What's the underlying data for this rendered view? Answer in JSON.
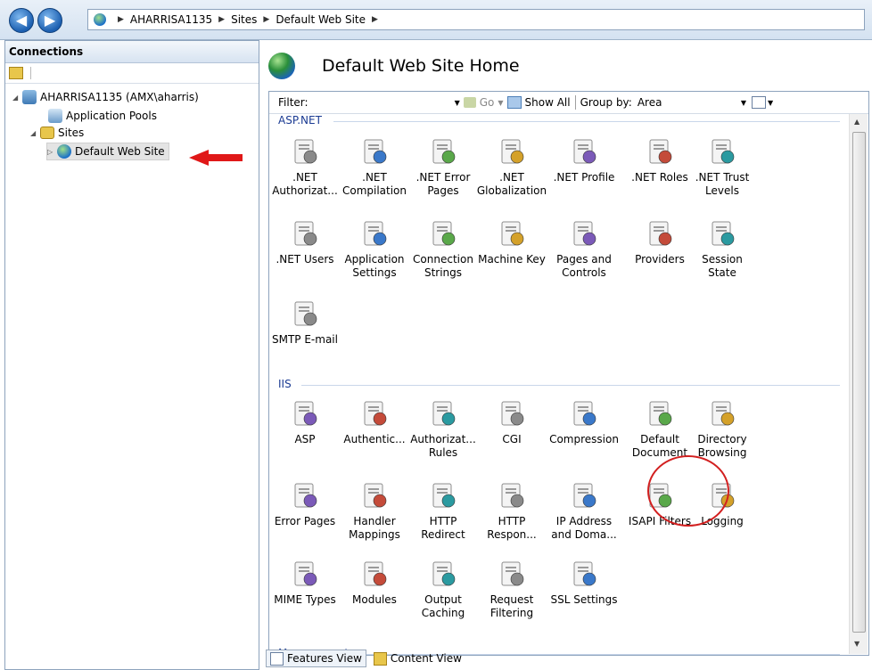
{
  "breadcrumb": [
    "AHARRISA1135",
    "Sites",
    "Default Web Site"
  ],
  "connections": {
    "title": "Connections",
    "tree": [
      {
        "label": "AHARRISA1135 (AMX\\aharris)",
        "icon": "server-icon",
        "expanded": true
      },
      {
        "label": "Application Pools",
        "icon": "app-pools-icon"
      },
      {
        "label": "Sites",
        "icon": "sites-folder-icon",
        "expanded": true
      },
      {
        "label": "Default Web Site",
        "icon": "globe-icon",
        "selected": true
      }
    ]
  },
  "main": {
    "title": "Default Web Site Home",
    "filter_label": "Filter:",
    "go_label": "Go",
    "show_all_label": "Show All",
    "group_by_label": "Group by:",
    "group_by_value": "Area"
  },
  "groups": {
    "aspnet": {
      "label": "ASP.NET",
      "items": [
        {
          "label": ".NET Authorizat...",
          "icon": "net-authorization-icon"
        },
        {
          "label": ".NET Compilation",
          "icon": "net-compilation-icon"
        },
        {
          "label": ".NET Error Pages",
          "icon": "net-error-pages-icon"
        },
        {
          "label": ".NET Globalization",
          "icon": "net-globalization-icon"
        },
        {
          "label": ".NET Profile",
          "icon": "net-profile-icon"
        },
        {
          "label": ".NET Roles",
          "icon": "net-roles-icon"
        },
        {
          "label": ".NET Trust Levels",
          "icon": "net-trust-levels-icon"
        },
        {
          "label": ".NET Users",
          "icon": "net-users-icon"
        },
        {
          "label": "Application Settings",
          "icon": "application-settings-icon"
        },
        {
          "label": "Connection Strings",
          "icon": "connection-strings-icon"
        },
        {
          "label": "Machine Key",
          "icon": "machine-key-icon"
        },
        {
          "label": "Pages and Controls",
          "icon": "pages-controls-icon"
        },
        {
          "label": "Providers",
          "icon": "providers-icon"
        },
        {
          "label": "Session State",
          "icon": "session-state-icon"
        },
        {
          "label": "SMTP E-mail",
          "icon": "smtp-email-icon"
        }
      ]
    },
    "iis": {
      "label": "IIS",
      "items": [
        {
          "label": "ASP",
          "icon": "asp-icon"
        },
        {
          "label": "Authentic...",
          "icon": "authentication-icon"
        },
        {
          "label": "Authorizat... Rules",
          "icon": "authorization-rules-icon"
        },
        {
          "label": "CGI",
          "icon": "cgi-icon"
        },
        {
          "label": "Compression",
          "icon": "compression-icon"
        },
        {
          "label": "Default Document",
          "icon": "default-document-icon"
        },
        {
          "label": "Directory Browsing",
          "icon": "directory-browsing-icon"
        },
        {
          "label": "Error Pages",
          "icon": "error-pages-icon"
        },
        {
          "label": "Handler Mappings",
          "icon": "handler-mappings-icon"
        },
        {
          "label": "HTTP Redirect",
          "icon": "http-redirect-icon"
        },
        {
          "label": "HTTP Respon...",
          "icon": "http-response-headers-icon"
        },
        {
          "label": "IP Address and Doma...",
          "icon": "ip-domain-restrictions-icon"
        },
        {
          "label": "ISAPI Filters",
          "icon": "isapi-filters-icon"
        },
        {
          "label": "Logging",
          "icon": "logging-icon"
        },
        {
          "label": "MIME Types",
          "icon": "mime-types-icon"
        },
        {
          "label": "Modules",
          "icon": "modules-icon"
        },
        {
          "label": "Output Caching",
          "icon": "output-caching-icon"
        },
        {
          "label": "Request Filtering",
          "icon": "request-filtering-icon"
        },
        {
          "label": "SSL Settings",
          "icon": "ssl-settings-icon"
        }
      ]
    },
    "management": {
      "label": "Management"
    }
  },
  "bottom_tabs": [
    "Features View",
    "Content View"
  ],
  "colors": {
    "accent": "#1b3b93",
    "annotation": "#d21f1f"
  }
}
